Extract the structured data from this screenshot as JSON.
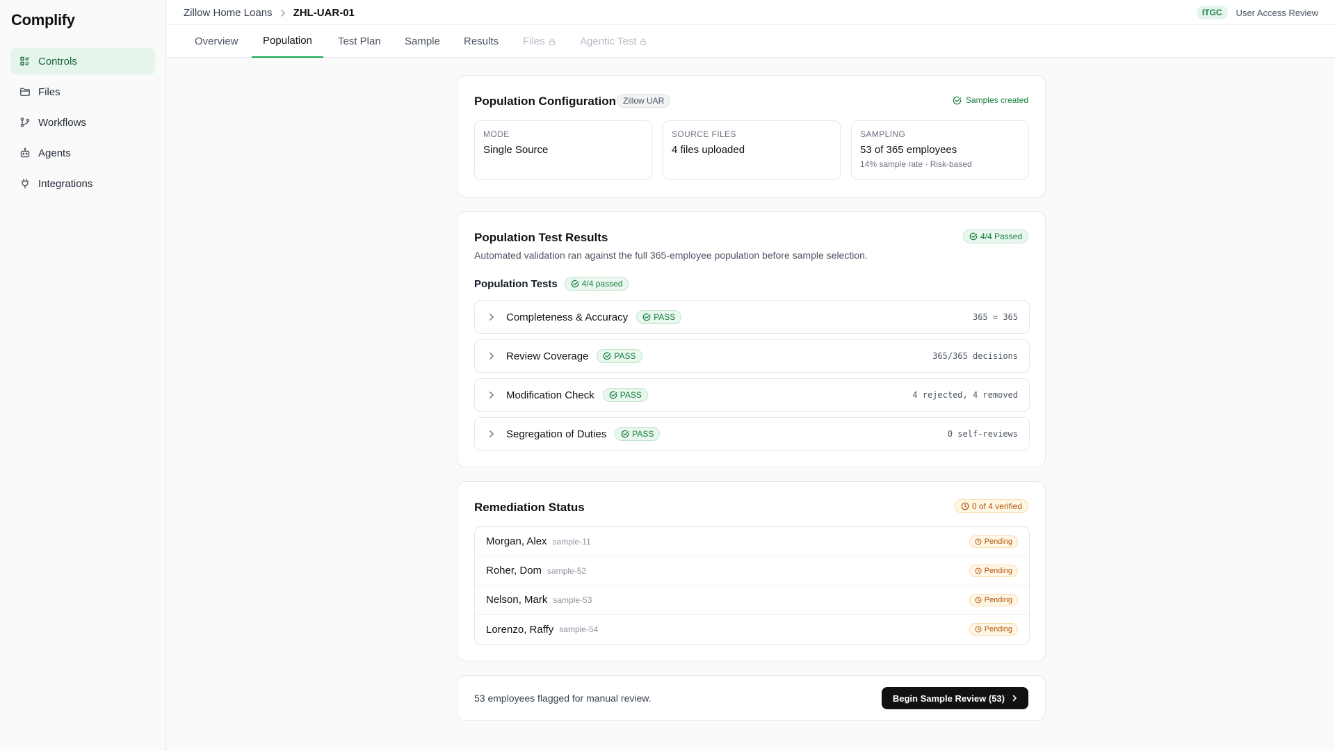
{
  "app": {
    "name": "Complify"
  },
  "sidebar": {
    "items": [
      {
        "label": "Controls",
        "icon": "list-icon",
        "active": true
      },
      {
        "label": "Files",
        "icon": "folder-icon"
      },
      {
        "label": "Workflows",
        "icon": "git-branch-icon"
      },
      {
        "label": "Agents",
        "icon": "bot-icon"
      },
      {
        "label": "Integrations",
        "icon": "plug-icon"
      }
    ]
  },
  "header": {
    "breadcrumb": {
      "parent": "Zillow Home Loans",
      "current": "ZHL-UAR-01"
    },
    "tag": "ITGC",
    "control_name": "User Access Review"
  },
  "tabs": [
    {
      "label": "Overview"
    },
    {
      "label": "Population",
      "active": true
    },
    {
      "label": "Test Plan"
    },
    {
      "label": "Sample"
    },
    {
      "label": "Results"
    },
    {
      "label": "Files",
      "locked": true
    },
    {
      "label": "Agentic Test",
      "locked": true
    }
  ],
  "config": {
    "title": "Population Configuration",
    "source_tag": "Zillow UAR",
    "status": "Samples created",
    "boxes": [
      {
        "label": "MODE",
        "value": "Single Source",
        "sub": ""
      },
      {
        "label": "SOURCE FILES",
        "value": "4 files uploaded",
        "sub": ""
      },
      {
        "label": "SAMPLING",
        "value": "53 of 365 employees",
        "sub": "14% sample rate · Risk-based"
      }
    ]
  },
  "results": {
    "title": "Population Test Results",
    "badge": "4/4 Passed",
    "description": "Automated validation ran against the full 365-employee population before sample selection.",
    "tests_label": "Population Tests",
    "tests_badge": "4/4 passed",
    "tests": [
      {
        "name": "Completeness & Accuracy",
        "status": "PASS",
        "detail": "365 = 365"
      },
      {
        "name": "Review Coverage",
        "status": "PASS",
        "detail": "365/365 decisions"
      },
      {
        "name": "Modification Check",
        "status": "PASS",
        "detail": "4 rejected, 4 removed"
      },
      {
        "name": "Segregation of Duties",
        "status": "PASS",
        "detail": "0 self-reviews"
      }
    ]
  },
  "remediation": {
    "title": "Remediation Status",
    "badge": "0 of 4 verified",
    "rows": [
      {
        "name": "Morgan, Alex",
        "sample": "sample-11",
        "status": "Pending"
      },
      {
        "name": "Roher, Dom",
        "sample": "sample-52",
        "status": "Pending"
      },
      {
        "name": "Nelson, Mark",
        "sample": "sample-53",
        "status": "Pending"
      },
      {
        "name": "Lorenzo, Raffy",
        "sample": "sample-54",
        "status": "Pending"
      }
    ]
  },
  "footer": {
    "message": "53 employees flagged for manual review.",
    "button": "Begin Sample Review (53)"
  },
  "colors": {
    "accent": "#16a34a",
    "pass": "#15803d",
    "pending": "#b45309",
    "primary_button": "#111111"
  }
}
